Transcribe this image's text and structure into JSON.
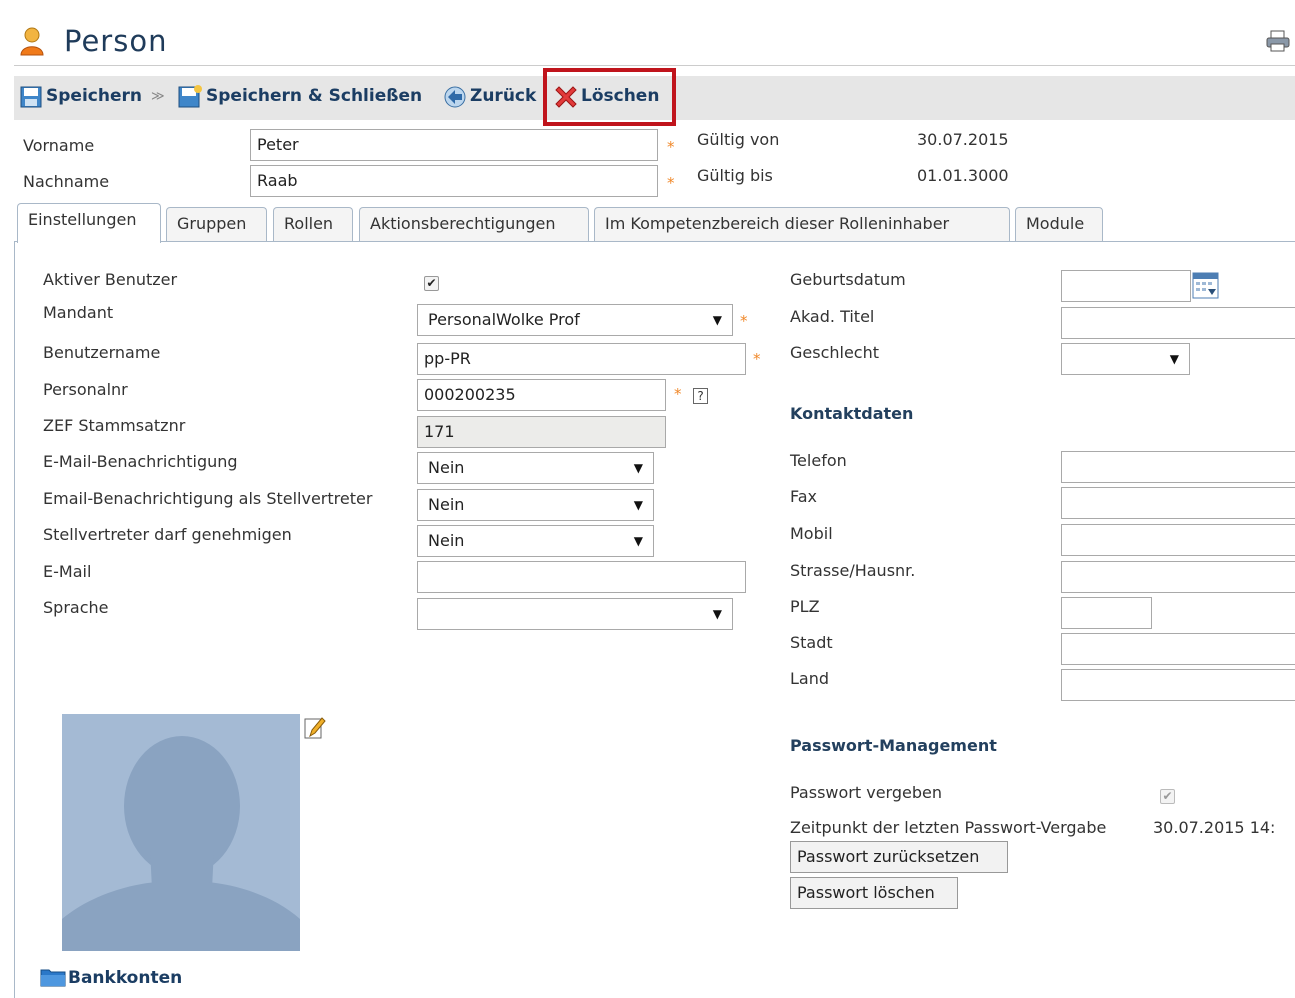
{
  "header": {
    "title": "Person"
  },
  "toolbar": {
    "save": "Speichern",
    "save_close": "Speichern & Schließen",
    "back": "Zurück",
    "delete": "Löschen"
  },
  "top_fields": {
    "vorname_label": "Vorname",
    "vorname_value": "Peter",
    "nachname_label": "Nachname",
    "nachname_value": "Raab",
    "gueltig_von_label": "Gültig von",
    "gueltig_von_value": "30.07.2015",
    "gueltig_bis_label": "Gültig bis",
    "gueltig_bis_value": "01.01.3000",
    "required_mark": "*"
  },
  "tabs": [
    {
      "label": "Einstellungen",
      "active": true
    },
    {
      "label": "Gruppen"
    },
    {
      "label": "Rollen"
    },
    {
      "label": "Aktionsberechtigungen"
    },
    {
      "label": "Im Kompetenzbereich dieser Rolleninhaber"
    },
    {
      "label": "Module"
    }
  ],
  "settings": {
    "aktiver_benutzer_label": "Aktiver Benutzer",
    "aktiver_benutzer_checked": true,
    "mandant_label": "Mandant",
    "mandant_value": "PersonalWolke Prof",
    "benutzername_label": "Benutzername",
    "benutzername_value": "pp-PR",
    "personalnr_label": "Personalnr",
    "personalnr_value": "000200235",
    "help_mark": "?",
    "zef_label": "ZEF Stammsatznr",
    "zef_value": "171",
    "email_benachrichtigung_label": "E-Mail-Benachrichtigung",
    "email_benachrichtigung_value": "Nein",
    "email_stellvertreter_label": "Email-Benachrichtigung als Stellvertreter",
    "email_stellvertreter_value": "Nein",
    "stellvertreter_genehmigen_label": "Stellvertreter darf genehmigen",
    "stellvertreter_genehmigen_value": "Nein",
    "email_label": "E-Mail",
    "email_value": "",
    "sprache_label": "Sprache",
    "sprache_value": ""
  },
  "right": {
    "geburtsdatum_label": "Geburtsdatum",
    "akad_titel_label": "Akad. Titel",
    "geschlecht_label": "Geschlecht",
    "kontaktdaten_heading": "Kontaktdaten",
    "telefon_label": "Telefon",
    "fax_label": "Fax",
    "mobil_label": "Mobil",
    "strasse_label": "Strasse/Hausnr.",
    "plz_label": "PLZ",
    "stadt_label": "Stadt",
    "land_label": "Land",
    "passwort_heading": "Passwort-Management",
    "passwort_vergeben_label": "Passwort vergeben",
    "passwort_vergeben_checked": true,
    "letzte_vergabe_label": "Zeitpunkt der letzten Passwort-Vergabe",
    "letzte_vergabe_value": "30.07.2015 14:",
    "reset_button": "Passwort zurücksetzen",
    "delete_button": "Passwort löschen"
  },
  "bank": {
    "label": "Bankkonten"
  },
  "colors": {
    "accent": "#1b3d63",
    "highlight_border": "#c0141c",
    "required": "#f0882a"
  }
}
